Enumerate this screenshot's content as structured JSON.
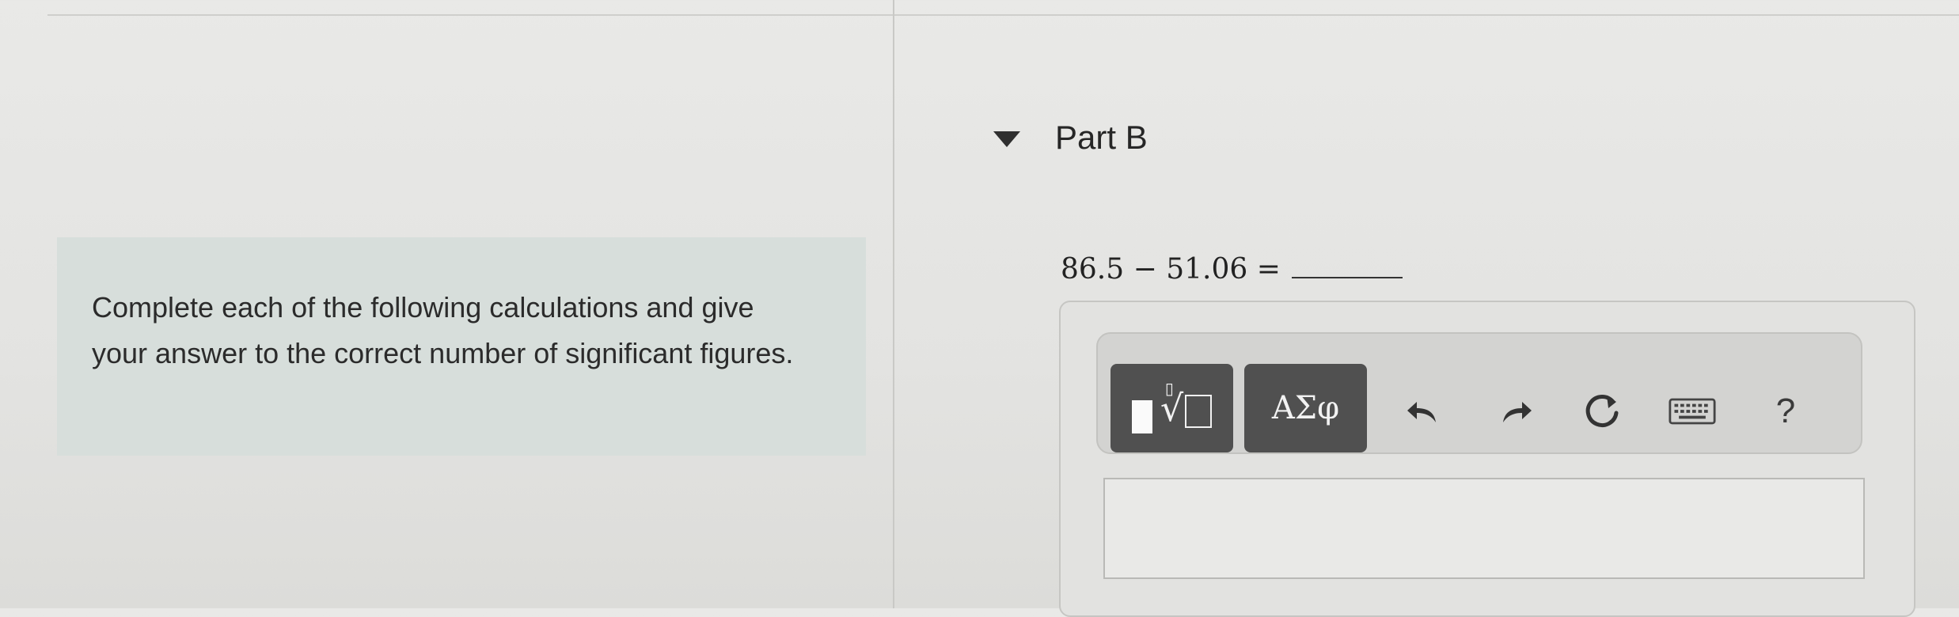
{
  "instructions": "Complete each of the following calculations and give your answer to the correct number of significant figures.",
  "part": {
    "title": "Part B"
  },
  "question": {
    "equation": "86.5 − 51.06 ="
  },
  "toolbar": {
    "templates_icon": "template-radical-icon",
    "symbols_label": "ΑΣφ",
    "undo_icon": "undo-icon",
    "redo_icon": "redo-icon",
    "reset_icon": "reset-icon",
    "keyboard_icon": "keyboard-icon",
    "help_label": "?"
  },
  "answer": {
    "value": ""
  },
  "colors": {
    "button_dark": "#505050",
    "instruction_bg": "#d7dedb"
  }
}
